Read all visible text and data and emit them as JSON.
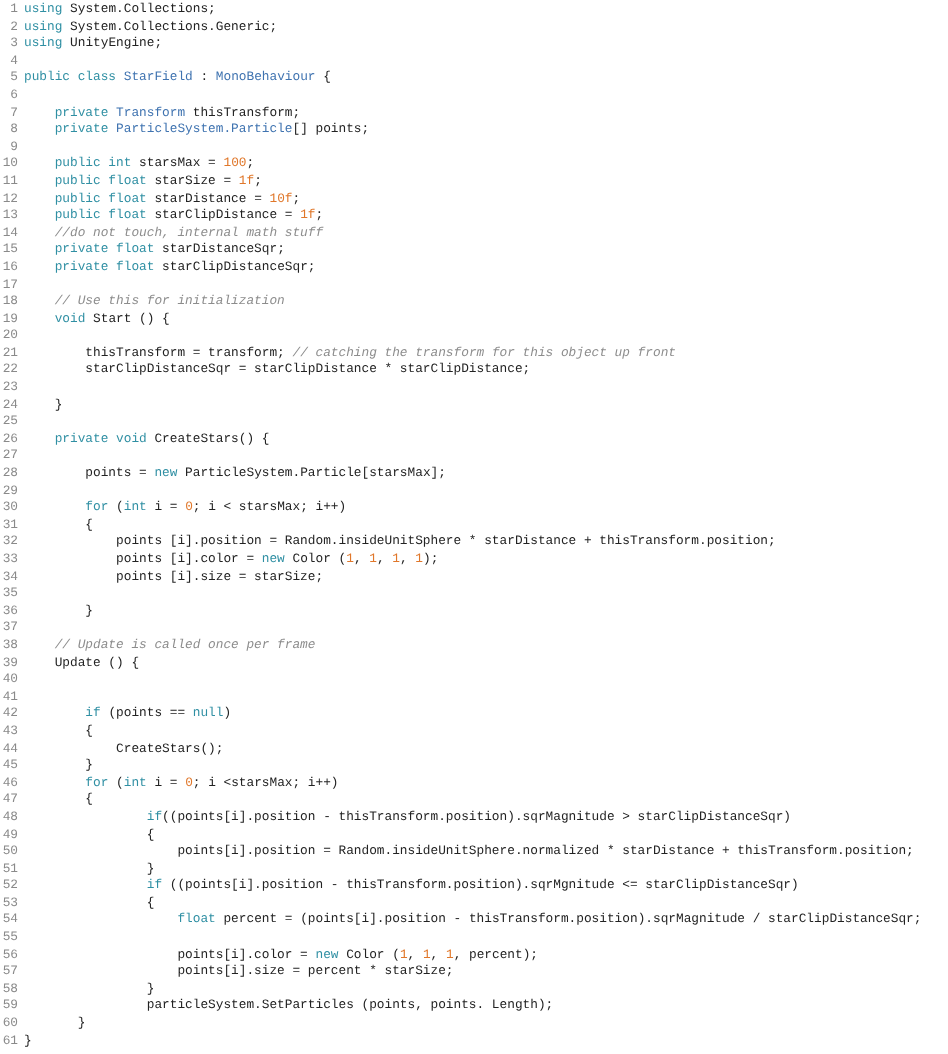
{
  "editor": {
    "lines": [
      {
        "number": "1",
        "tokens": [
          {
            "kind": "keyword",
            "text": "using"
          },
          {
            "kind": "plain",
            "text": " System.Collections;"
          }
        ]
      },
      {
        "number": "2",
        "tokens": [
          {
            "kind": "keyword",
            "text": "using"
          },
          {
            "kind": "plain",
            "text": " System.Collections.Generic;"
          }
        ]
      },
      {
        "number": "3",
        "tokens": [
          {
            "kind": "keyword",
            "text": "using"
          },
          {
            "kind": "plain",
            "text": " UnityEngine;"
          }
        ]
      },
      {
        "number": "4"
      },
      {
        "number": "5",
        "tokens": [
          {
            "kind": "keyword",
            "text": "public class"
          },
          {
            "kind": "type",
            "text": " StarField"
          },
          {
            "kind": "plain",
            "text": " : "
          },
          {
            "kind": "type",
            "text": "MonoBehaviour"
          },
          {
            "kind": "plain",
            "text": " {"
          }
        ]
      },
      {
        "number": "6"
      },
      {
        "number": "7",
        "tokens": [
          {
            "kind": "keyword",
            "text": "    private"
          },
          {
            "kind": "type",
            "text": " Transform"
          },
          {
            "kind": "plain",
            "text": " thisTransform;"
          }
        ]
      },
      {
        "number": "8",
        "tokens": [
          {
            "kind": "keyword",
            "text": "    private"
          },
          {
            "kind": "type",
            "text": " ParticleSystem.Particle"
          },
          {
            "kind": "plain",
            "text": "[] points;"
          }
        ]
      },
      {
        "number": "9"
      },
      {
        "number": "10",
        "tokens": [
          {
            "kind": "keyword",
            "text": "    public int"
          },
          {
            "kind": "plain",
            "text": " starsMax = "
          },
          {
            "kind": "number",
            "text": "100"
          },
          {
            "kind": "plain",
            "text": ";"
          }
        ]
      },
      {
        "number": "11",
        "tokens": [
          {
            "kind": "keyword",
            "text": "    public float"
          },
          {
            "kind": "plain",
            "text": " starSize = "
          },
          {
            "kind": "number",
            "text": "1f"
          },
          {
            "kind": "plain",
            "text": ";"
          }
        ]
      },
      {
        "number": "12",
        "tokens": [
          {
            "kind": "keyword",
            "text": "    public float"
          },
          {
            "kind": "plain",
            "text": " starDistance = "
          },
          {
            "kind": "number",
            "text": "10f"
          },
          {
            "kind": "plain",
            "text": ";"
          }
        ]
      },
      {
        "number": "13",
        "tokens": [
          {
            "kind": "keyword",
            "text": "    public float"
          },
          {
            "kind": "plain",
            "text": " starClipDistance = "
          },
          {
            "kind": "number",
            "text": "1f"
          },
          {
            "kind": "plain",
            "text": ";"
          }
        ]
      },
      {
        "number": "14",
        "tokens": [
          {
            "kind": "comment",
            "text": "    //do not touch, internal math stuff"
          }
        ]
      },
      {
        "number": "15",
        "tokens": [
          {
            "kind": "keyword",
            "text": "    private float"
          },
          {
            "kind": "plain",
            "text": " starDistanceSqr;"
          }
        ]
      },
      {
        "number": "16",
        "tokens": [
          {
            "kind": "keyword",
            "text": "    private float"
          },
          {
            "kind": "plain",
            "text": " starClipDistanceSqr;"
          }
        ]
      },
      {
        "number": "17"
      },
      {
        "number": "18",
        "tokens": [
          {
            "kind": "comment",
            "text": "    // Use this for initialization"
          }
        ]
      },
      {
        "number": "19",
        "tokens": [
          {
            "kind": "keyword",
            "text": "    void"
          },
          {
            "kind": "plain",
            "text": " Start () {"
          }
        ]
      },
      {
        "number": "20"
      },
      {
        "number": "21",
        "tokens": [
          {
            "kind": "plain",
            "text": "        thisTransform = transform; "
          },
          {
            "kind": "comment",
            "text": "// catching the transform for this object up front"
          }
        ]
      },
      {
        "number": "22",
        "tokens": [
          {
            "kind": "plain",
            "text": "        starClipDistanceSqr = starClipDistance * starClipDistance;"
          }
        ]
      },
      {
        "number": "23"
      },
      {
        "number": "24",
        "tokens": [
          {
            "kind": "plain",
            "text": "    }"
          }
        ]
      },
      {
        "number": "25"
      },
      {
        "number": "26",
        "tokens": [
          {
            "kind": "keyword",
            "text": "    private void"
          },
          {
            "kind": "plain",
            "text": " CreateStars() {"
          }
        ]
      },
      {
        "number": "27"
      },
      {
        "number": "28",
        "tokens": [
          {
            "kind": "plain",
            "text": "        points = "
          },
          {
            "kind": "keyword",
            "text": "new"
          },
          {
            "kind": "plain",
            "text": " ParticleSystem.Particle[starsMax];"
          }
        ]
      },
      {
        "number": "29"
      },
      {
        "number": "30",
        "tokens": [
          {
            "kind": "keyword",
            "text": "        for"
          },
          {
            "kind": "plain",
            "text": " ("
          },
          {
            "kind": "keyword",
            "text": "int"
          },
          {
            "kind": "plain",
            "text": " i = "
          },
          {
            "kind": "number",
            "text": "0"
          },
          {
            "kind": "plain",
            "text": "; i < starsMax; i++)"
          }
        ]
      },
      {
        "number": "31",
        "tokens": [
          {
            "kind": "plain",
            "text": "        {"
          }
        ]
      },
      {
        "number": "32",
        "tokens": [
          {
            "kind": "plain",
            "text": "            points [i].position = Random.insideUnitSphere * starDistance + thisTransform.position;"
          }
        ]
      },
      {
        "number": "33",
        "tokens": [
          {
            "kind": "plain",
            "text": "            points [i].color = "
          },
          {
            "kind": "keyword",
            "text": "new"
          },
          {
            "kind": "plain",
            "text": " Color ("
          },
          {
            "kind": "number",
            "text": "1"
          },
          {
            "kind": "plain",
            "text": ", "
          },
          {
            "kind": "number",
            "text": "1"
          },
          {
            "kind": "plain",
            "text": ", "
          },
          {
            "kind": "number",
            "text": "1"
          },
          {
            "kind": "plain",
            "text": ", "
          },
          {
            "kind": "number",
            "text": "1"
          },
          {
            "kind": "plain",
            "text": ");"
          }
        ]
      },
      {
        "number": "34",
        "tokens": [
          {
            "kind": "plain",
            "text": "            points [i].size = starSize;"
          }
        ]
      },
      {
        "number": "35"
      },
      {
        "number": "36",
        "tokens": [
          {
            "kind": "plain",
            "text": "        }"
          }
        ]
      },
      {
        "number": "37"
      },
      {
        "number": "38",
        "tokens": [
          {
            "kind": "comment",
            "text": "    // Update is called once per frame"
          }
        ]
      },
      {
        "number": "39",
        "tokens": [
          {
            "kind": "plain",
            "text": "    Update () {"
          }
        ]
      },
      {
        "number": "40"
      },
      {
        "number": "41"
      },
      {
        "number": "42",
        "tokens": [
          {
            "kind": "keyword",
            "text": "        if"
          },
          {
            "kind": "plain",
            "text": " (points == "
          },
          {
            "kind": "keyword",
            "text": "null"
          },
          {
            "kind": "plain",
            "text": ")"
          }
        ]
      },
      {
        "number": "43",
        "tokens": [
          {
            "kind": "plain",
            "text": "        {"
          }
        ]
      },
      {
        "number": "44",
        "tokens": [
          {
            "kind": "plain",
            "text": "            CreateStars();"
          }
        ]
      },
      {
        "number": "45",
        "tokens": [
          {
            "kind": "plain",
            "text": "        }"
          }
        ]
      },
      {
        "number": "46",
        "tokens": [
          {
            "kind": "keyword",
            "text": "        for"
          },
          {
            "kind": "plain",
            "text": " ("
          },
          {
            "kind": "keyword",
            "text": "int"
          },
          {
            "kind": "plain",
            "text": " i = "
          },
          {
            "kind": "number",
            "text": "0"
          },
          {
            "kind": "plain",
            "text": "; i <starsMax; i++)"
          }
        ]
      },
      {
        "number": "47",
        "tokens": [
          {
            "kind": "plain",
            "text": "        {"
          }
        ]
      },
      {
        "number": "48",
        "tokens": [
          {
            "kind": "keyword",
            "text": "                if"
          },
          {
            "kind": "plain",
            "text": "((points[i].position - thisTransform.position).sqrMagnitude > starClipDistanceSqr)"
          }
        ]
      },
      {
        "number": "49",
        "tokens": [
          {
            "kind": "plain",
            "text": "                {"
          }
        ]
      },
      {
        "number": "50",
        "tokens": [
          {
            "kind": "plain",
            "text": "                    points[i].position = Random.insideUnitSphere.normalized * starDistance + thisTransform.position;"
          }
        ]
      },
      {
        "number": "51",
        "tokens": [
          {
            "kind": "plain",
            "text": "                }"
          }
        ]
      },
      {
        "number": "52",
        "tokens": [
          {
            "kind": "keyword",
            "text": "                if"
          },
          {
            "kind": "plain",
            "text": " ((points[i].position - thisTransform.position).sqrMgnitude <= starClipDistanceSqr)"
          }
        ]
      },
      {
        "number": "53",
        "tokens": [
          {
            "kind": "plain",
            "text": "                {"
          }
        ]
      },
      {
        "number": "54",
        "tokens": [
          {
            "kind": "keyword",
            "text": "                    float"
          },
          {
            "kind": "plain",
            "text": " percent = (points[i].position - thisTransform.position).sqrMagnitude / starClipDistanceSqr;"
          }
        ]
      },
      {
        "number": "55"
      },
      {
        "number": "56",
        "tokens": [
          {
            "kind": "plain",
            "text": "                    points[i].color = "
          },
          {
            "kind": "keyword",
            "text": "new"
          },
          {
            "kind": "plain",
            "text": " Color ("
          },
          {
            "kind": "number",
            "text": "1"
          },
          {
            "kind": "plain",
            "text": ", "
          },
          {
            "kind": "number",
            "text": "1"
          },
          {
            "kind": "plain",
            "text": ", "
          },
          {
            "kind": "number",
            "text": "1"
          },
          {
            "kind": "plain",
            "text": ", percent);"
          }
        ]
      },
      {
        "number": "57",
        "tokens": [
          {
            "kind": "plain",
            "text": "                    points[i].size = percent * starSize;"
          }
        ]
      },
      {
        "number": "58",
        "tokens": [
          {
            "kind": "plain",
            "text": "                }"
          }
        ]
      },
      {
        "number": "59",
        "tokens": [
          {
            "kind": "plain",
            "text": "                particleSystem.SetParticles (points, points. Length);"
          }
        ]
      },
      {
        "number": "60",
        "tokens": [
          {
            "kind": "plain",
            "text": "       }"
          }
        ]
      },
      {
        "number": "61",
        "tokens": [
          {
            "kind": "plain",
            "text": "}"
          }
        ]
      }
    ]
  }
}
